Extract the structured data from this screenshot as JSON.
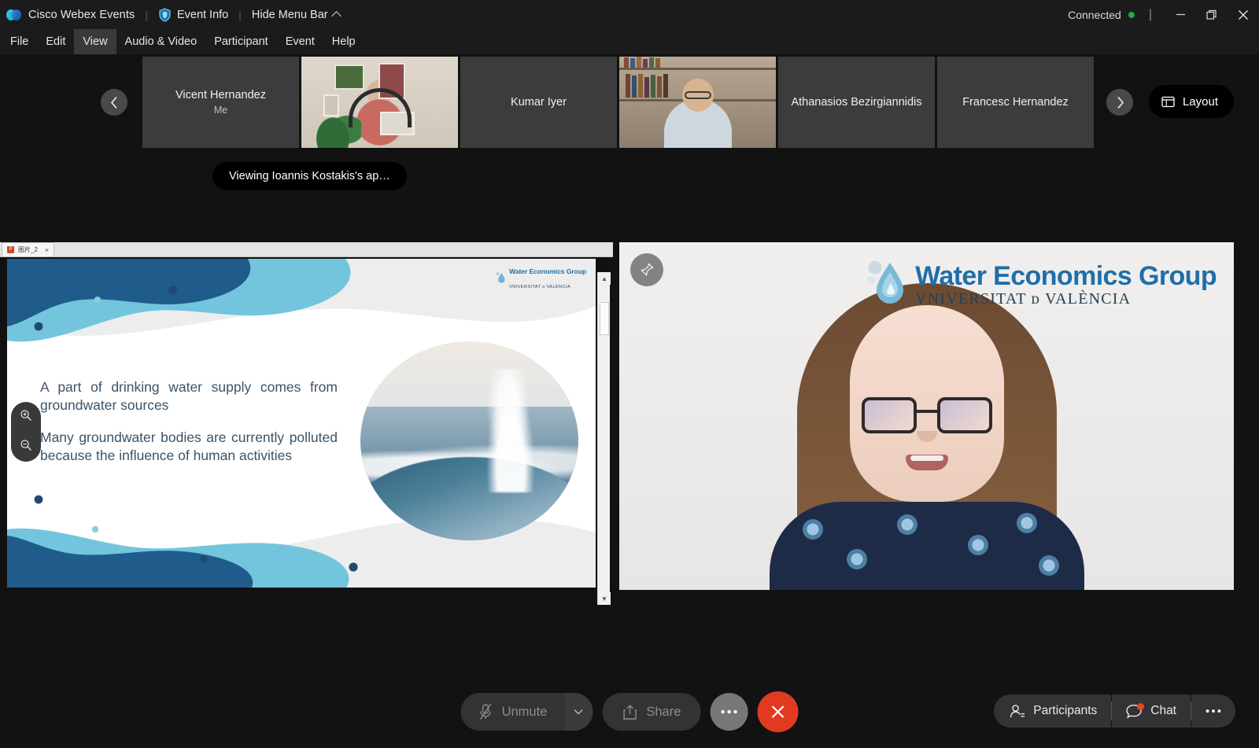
{
  "titlebar": {
    "app_name": "Cisco Webex Events",
    "separator": "|",
    "event_info_label": "Event Info",
    "hide_menu_label": "Hide Menu Bar",
    "connection_status": "Connected",
    "status_color": "#1ea94b",
    "divider": "|",
    "icons": {
      "webex": "webex-logo-icon",
      "shield": "shield-icon",
      "chevron_up": "chevron-up-icon",
      "minimize": "minimize-icon",
      "restore": "restore-icon",
      "close": "close-icon"
    }
  },
  "menubar": {
    "items": [
      {
        "label": "File",
        "active": false
      },
      {
        "label": "Edit",
        "active": false
      },
      {
        "label": "View",
        "active": true
      },
      {
        "label": "Audio & Video",
        "active": false
      },
      {
        "label": "Participant",
        "active": false
      },
      {
        "label": "Event",
        "active": false
      },
      {
        "label": "Help",
        "active": false
      }
    ]
  },
  "filmstrip": {
    "prev_label": "‹",
    "next_label": "›",
    "tiles": [
      {
        "name": "Vicent Hernandez",
        "subtitle": "Me",
        "has_video": false
      },
      {
        "name": "",
        "subtitle": "",
        "has_video": true,
        "video_style": "home-office"
      },
      {
        "name": "Kumar Iyer",
        "subtitle": "",
        "has_video": false
      },
      {
        "name": "",
        "subtitle": "",
        "has_video": true,
        "video_style": "bookshelf"
      },
      {
        "name": "Athanasios Bezirgiannidis",
        "subtitle": "",
        "has_video": false
      },
      {
        "name": "Francesc Hernandez",
        "subtitle": "",
        "has_video": false
      }
    ],
    "layout_button": "Layout",
    "layout_icon": "layout-grid-icon"
  },
  "viewing_banner": {
    "text": "Viewing Ioannis Kostakis's ap…"
  },
  "shared_content": {
    "tab_title": "图片_2",
    "tab_icon": "powerpoint-icon",
    "tab_close": "×",
    "slide": {
      "logo_title": "Water Economics Group",
      "logo_subtitle": "VNIVERSITAT ᴅ VALÈNCIA",
      "paragraphs": [
        "A part of drinking water supply comes from groundwater sources",
        "Many groundwater bodies are currently polluted because the influence of human activities"
      ],
      "colors": {
        "wave_dark": "#1f5c8b",
        "wave_light": "#72c5dc",
        "wave_gray": "#ededed",
        "dot_dark": "#1f4a73",
        "dot_light": "#8ecbdc",
        "text": "#3b5368"
      },
      "photo_alt": "water-splash-photo"
    },
    "zoom_in_icon": "zoom-in-icon",
    "zoom_out_icon": "zoom-out-icon",
    "scrollbar": {
      "up_arrow": "▲",
      "down_arrow": "▼"
    }
  },
  "presenter": {
    "pin_icon": "pin-icon",
    "logo_title": "Water Economics Group",
    "logo_subtitle": "VNIVERSITAT ᴅ VALÈNCIA",
    "logo_color": "#1f6fa8",
    "video_alt": "presenter-webcam-video"
  },
  "bottombar": {
    "mute_label": "Unmute",
    "mute_icon": "microphone-muted-icon",
    "mute_caret_icon": "chevron-down-icon",
    "share_label": "Share",
    "share_icon": "share-upload-icon",
    "more_label": "···",
    "more_icon": "ellipsis-icon",
    "end_icon": "close-icon",
    "end_color": "#e03a21",
    "participants_label": "Participants",
    "participants_icon": "people-icon",
    "chat_label": "Chat",
    "chat_icon": "chat-bubble-icon",
    "chat_badge_color": "#e8452c",
    "overflow_label": "···",
    "overflow_icon": "ellipsis-icon"
  }
}
